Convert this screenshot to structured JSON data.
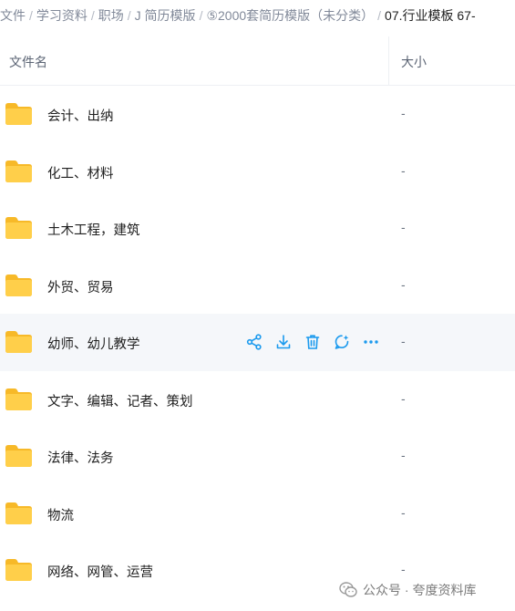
{
  "breadcrumb": [
    {
      "label": "文件",
      "current": false
    },
    {
      "label": "学习资料",
      "current": false
    },
    {
      "label": "职场",
      "current": false
    },
    {
      "label": "J 简历模版",
      "current": false
    },
    {
      "label": "⑤2000套简历模版（未分类）",
      "current": false
    },
    {
      "label": "07.行业模板 67-",
      "current": true
    }
  ],
  "header": {
    "name": "文件名",
    "size": "大小"
  },
  "folders": [
    {
      "name": "会计、出纳",
      "size": "-"
    },
    {
      "name": "化工、材料",
      "size": "-"
    },
    {
      "name": "土木工程，建筑",
      "size": "-"
    },
    {
      "name": "外贸、贸易",
      "size": "-"
    },
    {
      "name": "幼师、幼儿教学",
      "size": "-"
    },
    {
      "name": "文字、编辑、记者、策划",
      "size": "-"
    },
    {
      "name": "法律、法务",
      "size": "-"
    },
    {
      "name": "物流",
      "size": "-"
    },
    {
      "name": "网络、网管、运营",
      "size": "-"
    }
  ],
  "hover_row": 4,
  "row_actions": [
    "share-icon",
    "download-icon",
    "delete-icon",
    "chat-icon",
    "more-icon"
  ],
  "colors": {
    "accent": "#1b9aee",
    "folder": "#ffc83d",
    "hover_bg": "#f5f7fa"
  },
  "watermark": "公众号 · 夸度资料库"
}
